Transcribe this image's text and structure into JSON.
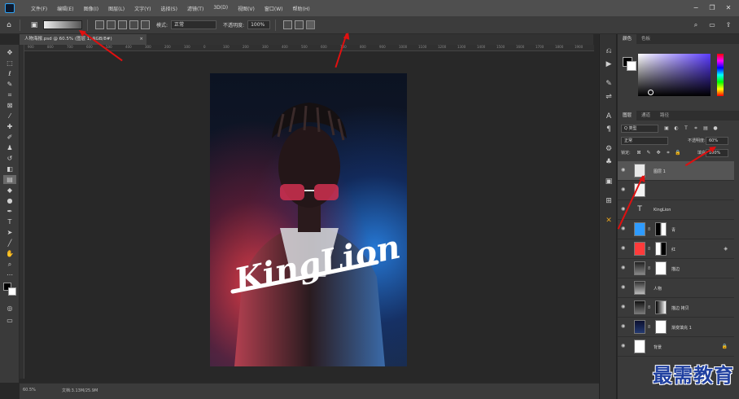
{
  "menubar": {
    "items": [
      "文件(F)",
      "编辑(E)",
      "图像(I)",
      "图层(L)",
      "文字(Y)",
      "选择(S)",
      "滤镜(T)",
      "3D(D)",
      "视图(V)",
      "窗口(W)",
      "帮助(H)"
    ]
  },
  "options": {
    "mode_label": "模式:",
    "mode_value": "正常",
    "opacity_label": "不透明度:",
    "opacity_value": "100%"
  },
  "document": {
    "tab_title": "人物海报.psd @ 60.5% (图层 1, RGB/8#)",
    "close": "×",
    "zoom": "60.5%",
    "doc_size": "文档:3.13M/25.9M"
  },
  "ruler_ticks": [
    "900",
    "800",
    "700",
    "600",
    "500",
    "400",
    "300",
    "200",
    "100",
    "0",
    "100",
    "200",
    "300",
    "400",
    "500",
    "600",
    "700",
    "800",
    "900",
    "1000",
    "1100",
    "1200",
    "1300",
    "1400",
    "1500",
    "1600",
    "1700",
    "1800",
    "1900"
  ],
  "color_panel": {
    "tabs": [
      "颜色",
      "色板"
    ]
  },
  "layers_panel": {
    "tabs": [
      "图层",
      "通道",
      "路径"
    ],
    "filter_label": "Q 类型",
    "blend_mode": "正常",
    "opacity_label": "不透明度:",
    "opacity_value": "60%",
    "lock_label": "锁定:",
    "fill_label": "填充:",
    "fill_value": "100%",
    "layers": [
      {
        "name": "图层 1",
        "selected": true
      },
      {
        "name": "",
        "selected": false
      },
      {
        "name": "KingLion",
        "type": "text"
      },
      {
        "name": "青",
        "color": "#2e9bff"
      },
      {
        "name": "红",
        "color": "#ff3b3b"
      },
      {
        "name": "描边"
      },
      {
        "name": "人物"
      },
      {
        "name": "描边 拷贝"
      },
      {
        "name": "渐变填充 1"
      },
      {
        "name": "背景"
      }
    ]
  },
  "poster": {
    "brand": "KingLion"
  },
  "watermark": "最需教育",
  "colors": {
    "annotation_red": "#e01010",
    "accent_blue": "#2fa3f5"
  }
}
